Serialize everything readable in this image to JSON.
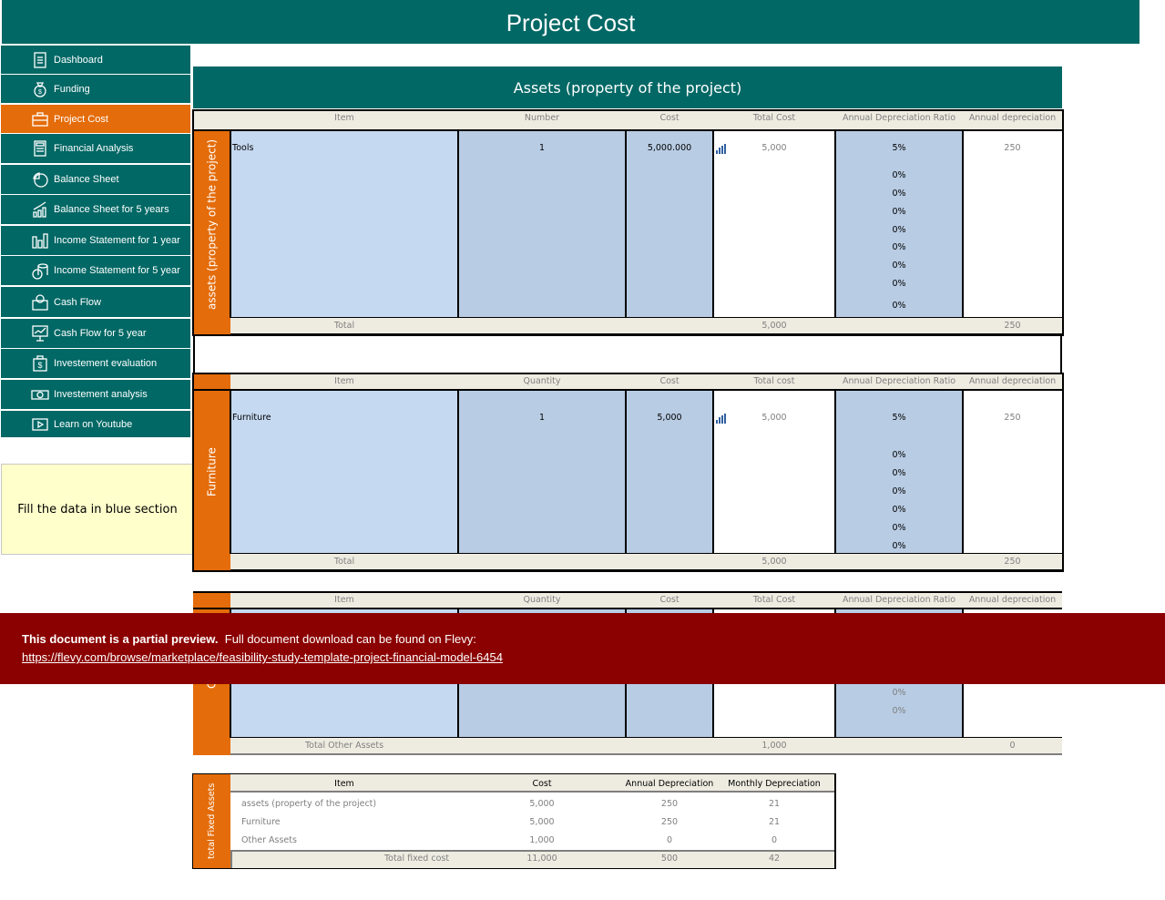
{
  "header": {
    "title": "Project Cost"
  },
  "sidebar": {
    "items": [
      {
        "label": "Dashboard",
        "icon": "clipboard-icon",
        "active": false
      },
      {
        "label": "Funding",
        "icon": "money-bag-icon",
        "active": false
      },
      {
        "label": "Project Cost",
        "icon": "briefcase-icon",
        "active": true
      },
      {
        "label": "Financial Analysis",
        "icon": "calculator-icon",
        "active": false
      },
      {
        "label": "Balance Sheet",
        "icon": "pie-chart-icon",
        "active": false
      },
      {
        "label": "Balance Sheet for 5 years",
        "icon": "growth-chart-icon",
        "active": false
      },
      {
        "label": "Income Statement for 1 year",
        "icon": "bar-chart-icon",
        "active": false
      },
      {
        "label": "Income Statement for 5 year",
        "icon": "coins-icon",
        "active": false
      },
      {
        "label": "Cash Flow",
        "icon": "wallet-icon",
        "active": false
      },
      {
        "label": "Cash Flow for 5 year",
        "icon": "presentation-icon",
        "active": false
      },
      {
        "label": "Investement evaluation",
        "icon": "dollar-bag-icon",
        "active": false
      },
      {
        "label": "Investement analysis",
        "icon": "banknote-icon",
        "active": false
      },
      {
        "label": "Learn on Youtube",
        "icon": "play-icon",
        "active": false
      }
    ],
    "colors": {
      "teal": "#016865",
      "active": "#e46c0a"
    }
  },
  "note": {
    "text": "Fill the data in blue section"
  },
  "main": {
    "section_title": "Assets (property of the project)",
    "tables": [
      {
        "side_label": "assets (property of the project)",
        "columns": [
          "Item",
          "Number",
          "Cost",
          "Total Cost",
          "Annual Depreciation Ratio",
          "Annual depreciation"
        ],
        "first_row": {
          "item": "Tools",
          "number": "1",
          "cost": "5,000.000",
          "total_cost": "5,000",
          "ratio": "5%",
          "annual_dep": "250"
        },
        "extra_ratios": [
          "0%",
          "0%",
          "0%",
          "0%",
          "0%",
          "0%",
          "0%",
          "0%"
        ],
        "total": {
          "label": "Total",
          "total_cost": "5,000",
          "annual_dep": "250"
        }
      },
      {
        "side_label": "Furniture",
        "columns": [
          "Item",
          "Quantity",
          "Cost",
          "Total cost",
          "Annual Depreciation Ratio",
          "Annual depreciation"
        ],
        "first_row": {
          "item": "Furniture",
          "number": "1",
          "cost": "5,000",
          "total_cost": "5,000",
          "ratio": "5%",
          "annual_dep": "250"
        },
        "extra_ratios": [
          "0%",
          "0%",
          "0%",
          "0%",
          "0%",
          "0%"
        ],
        "total": {
          "label": "Total",
          "total_cost": "5,000",
          "annual_dep": "250"
        }
      },
      {
        "side_label": "Other",
        "columns": [
          "Item",
          "Quantity",
          "Cost",
          "Total Cost",
          "Annual Depreciation Ratio",
          "Annual depreciation"
        ],
        "extra_ratios": [
          "0%",
          "0%"
        ],
        "total": {
          "label": "Total Other Assets",
          "total_cost": "1,000",
          "annual_dep": "0"
        }
      }
    ],
    "summary": {
      "side_label": "total Fixed Assets",
      "columns": [
        "Item",
        "Cost",
        "Annual Depreciation",
        "Monthly Depreciation"
      ],
      "rows": [
        {
          "item": "assets (property of the project)",
          "cost": "5,000",
          "annual": "250",
          "monthly": "21"
        },
        {
          "item": "Furniture",
          "cost": "5,000",
          "annual": "250",
          "monthly": "21"
        },
        {
          "item": "Other Assets",
          "cost": "1,000",
          "annual": "0",
          "monthly": "0"
        }
      ],
      "total": {
        "label": "Total fixed cost",
        "cost": "11,000",
        "annual": "500",
        "monthly": "42"
      }
    }
  },
  "banner": {
    "bold": "This document is a partial preview.",
    "text": "Full document download can be found on Flevy:",
    "link": "https://flevy.com/browse/marketplace/feasibility-study-template-project-financial-model-6454",
    "color": "#8b0000"
  }
}
